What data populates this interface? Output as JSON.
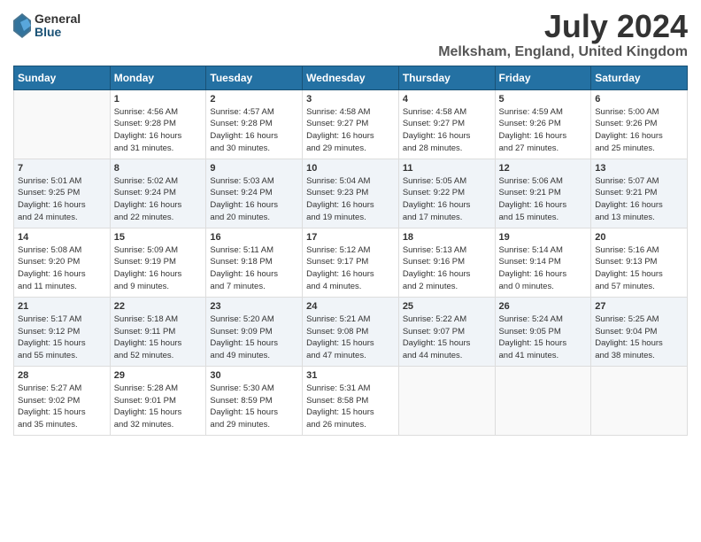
{
  "header": {
    "logo_general": "General",
    "logo_blue": "Blue",
    "title": "July 2024",
    "location": "Melksham, England, United Kingdom"
  },
  "calendar": {
    "days_of_week": [
      "Sunday",
      "Monday",
      "Tuesday",
      "Wednesday",
      "Thursday",
      "Friday",
      "Saturday"
    ],
    "weeks": [
      [
        {
          "date": "",
          "info": ""
        },
        {
          "date": "1",
          "info": "Sunrise: 4:56 AM\nSunset: 9:28 PM\nDaylight: 16 hours\nand 31 minutes."
        },
        {
          "date": "2",
          "info": "Sunrise: 4:57 AM\nSunset: 9:28 PM\nDaylight: 16 hours\nand 30 minutes."
        },
        {
          "date": "3",
          "info": "Sunrise: 4:58 AM\nSunset: 9:27 PM\nDaylight: 16 hours\nand 29 minutes."
        },
        {
          "date": "4",
          "info": "Sunrise: 4:58 AM\nSunset: 9:27 PM\nDaylight: 16 hours\nand 28 minutes."
        },
        {
          "date": "5",
          "info": "Sunrise: 4:59 AM\nSunset: 9:26 PM\nDaylight: 16 hours\nand 27 minutes."
        },
        {
          "date": "6",
          "info": "Sunrise: 5:00 AM\nSunset: 9:26 PM\nDaylight: 16 hours\nand 25 minutes."
        }
      ],
      [
        {
          "date": "7",
          "info": "Sunrise: 5:01 AM\nSunset: 9:25 PM\nDaylight: 16 hours\nand 24 minutes."
        },
        {
          "date": "8",
          "info": "Sunrise: 5:02 AM\nSunset: 9:24 PM\nDaylight: 16 hours\nand 22 minutes."
        },
        {
          "date": "9",
          "info": "Sunrise: 5:03 AM\nSunset: 9:24 PM\nDaylight: 16 hours\nand 20 minutes."
        },
        {
          "date": "10",
          "info": "Sunrise: 5:04 AM\nSunset: 9:23 PM\nDaylight: 16 hours\nand 19 minutes."
        },
        {
          "date": "11",
          "info": "Sunrise: 5:05 AM\nSunset: 9:22 PM\nDaylight: 16 hours\nand 17 minutes."
        },
        {
          "date": "12",
          "info": "Sunrise: 5:06 AM\nSunset: 9:21 PM\nDaylight: 16 hours\nand 15 minutes."
        },
        {
          "date": "13",
          "info": "Sunrise: 5:07 AM\nSunset: 9:21 PM\nDaylight: 16 hours\nand 13 minutes."
        }
      ],
      [
        {
          "date": "14",
          "info": "Sunrise: 5:08 AM\nSunset: 9:20 PM\nDaylight: 16 hours\nand 11 minutes."
        },
        {
          "date": "15",
          "info": "Sunrise: 5:09 AM\nSunset: 9:19 PM\nDaylight: 16 hours\nand 9 minutes."
        },
        {
          "date": "16",
          "info": "Sunrise: 5:11 AM\nSunset: 9:18 PM\nDaylight: 16 hours\nand 7 minutes."
        },
        {
          "date": "17",
          "info": "Sunrise: 5:12 AM\nSunset: 9:17 PM\nDaylight: 16 hours\nand 4 minutes."
        },
        {
          "date": "18",
          "info": "Sunrise: 5:13 AM\nSunset: 9:16 PM\nDaylight: 16 hours\nand 2 minutes."
        },
        {
          "date": "19",
          "info": "Sunrise: 5:14 AM\nSunset: 9:14 PM\nDaylight: 16 hours\nand 0 minutes."
        },
        {
          "date": "20",
          "info": "Sunrise: 5:16 AM\nSunset: 9:13 PM\nDaylight: 15 hours\nand 57 minutes."
        }
      ],
      [
        {
          "date": "21",
          "info": "Sunrise: 5:17 AM\nSunset: 9:12 PM\nDaylight: 15 hours\nand 55 minutes."
        },
        {
          "date": "22",
          "info": "Sunrise: 5:18 AM\nSunset: 9:11 PM\nDaylight: 15 hours\nand 52 minutes."
        },
        {
          "date": "23",
          "info": "Sunrise: 5:20 AM\nSunset: 9:09 PM\nDaylight: 15 hours\nand 49 minutes."
        },
        {
          "date": "24",
          "info": "Sunrise: 5:21 AM\nSunset: 9:08 PM\nDaylight: 15 hours\nand 47 minutes."
        },
        {
          "date": "25",
          "info": "Sunrise: 5:22 AM\nSunset: 9:07 PM\nDaylight: 15 hours\nand 44 minutes."
        },
        {
          "date": "26",
          "info": "Sunrise: 5:24 AM\nSunset: 9:05 PM\nDaylight: 15 hours\nand 41 minutes."
        },
        {
          "date": "27",
          "info": "Sunrise: 5:25 AM\nSunset: 9:04 PM\nDaylight: 15 hours\nand 38 minutes."
        }
      ],
      [
        {
          "date": "28",
          "info": "Sunrise: 5:27 AM\nSunset: 9:02 PM\nDaylight: 15 hours\nand 35 minutes."
        },
        {
          "date": "29",
          "info": "Sunrise: 5:28 AM\nSunset: 9:01 PM\nDaylight: 15 hours\nand 32 minutes."
        },
        {
          "date": "30",
          "info": "Sunrise: 5:30 AM\nSunset: 8:59 PM\nDaylight: 15 hours\nand 29 minutes."
        },
        {
          "date": "31",
          "info": "Sunrise: 5:31 AM\nSunset: 8:58 PM\nDaylight: 15 hours\nand 26 minutes."
        },
        {
          "date": "",
          "info": ""
        },
        {
          "date": "",
          "info": ""
        },
        {
          "date": "",
          "info": ""
        }
      ]
    ]
  }
}
